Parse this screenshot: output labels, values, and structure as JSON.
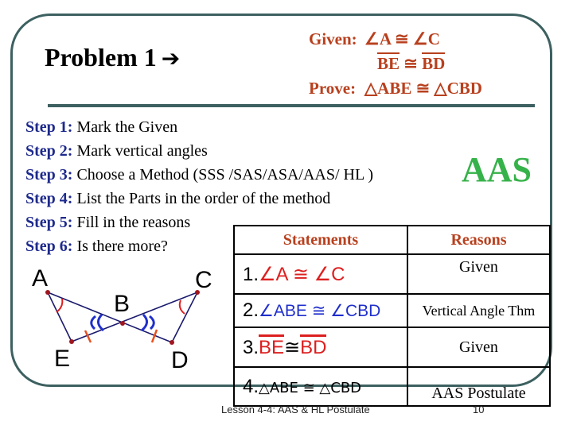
{
  "header": {
    "title": "Problem 1",
    "arrow_icon": "right-arrow-icon"
  },
  "given_box": {
    "given_label": "Given:",
    "given_line1": "∠A ≅ ∠C",
    "given_line2_left": "BE",
    "given_line2_sym": "≅",
    "given_line2_right": "BD",
    "prove_label": "Prove:",
    "prove_statement": "△ABE ≅ △CBD"
  },
  "steps": [
    {
      "label": "Step 1:",
      "text": "Mark the Given"
    },
    {
      "label": "Step 2:",
      "text": "Mark vertical angles"
    },
    {
      "label": "Step 3:",
      "text": "Choose a Method (SSS /SAS/ASA/AAS/ HL )"
    },
    {
      "label": "Step 4:",
      "text": "List the Parts in the order of the method"
    },
    {
      "label": "Step 5:",
      "text": "Fill in the reasons"
    },
    {
      "label": "Step 6:",
      "text": "Is there more?"
    }
  ],
  "method_answer": "AAS",
  "diagram": {
    "points": [
      "A",
      "B",
      "C",
      "D",
      "E"
    ]
  },
  "proof_table": {
    "headers": [
      "Statements",
      "Reasons"
    ],
    "rows": [
      {
        "num": "1.",
        "statement": "∠A ≅ ∠C",
        "reason": "Given"
      },
      {
        "num": "2.",
        "statement": "∠ABE ≅ ∠CBD",
        "reason": "Vertical Angle Thm"
      },
      {
        "num": "3.",
        "statement_left": "BE",
        "statement_sym": "≅",
        "statement_right": "BD",
        "reason": "Given"
      },
      {
        "num": "4.",
        "statement": "△ABE ≅ △CBD",
        "reason": "AAS Postulate"
      }
    ]
  },
  "footer": {
    "lesson": "Lesson 4-4: AAS & HL Postulate",
    "page_number": "10"
  },
  "colors": {
    "frame": "#3d6060",
    "given_text": "#b8401e",
    "step_label": "#1e2a8c",
    "method_answer": "#36b24a",
    "given_marks": "#dd1f1f",
    "vertical_marks": "#1f2fcc"
  }
}
